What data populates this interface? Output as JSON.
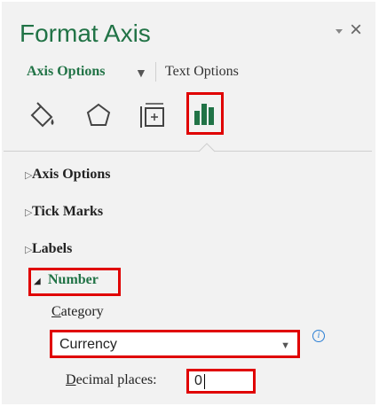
{
  "pane": {
    "title": "Format Axis",
    "pin_icon": "chevron-down-icon",
    "close_symbol": "×",
    "colors": {
      "accent": "#217346",
      "highlight": "#e00000",
      "info": "#2b7fd4"
    }
  },
  "tabs": {
    "axis_options_label": "Axis Options",
    "axis_options_caret": "▼",
    "text_options_label": "Text Options"
  },
  "icons": [
    {
      "name": "fill-line-icon"
    },
    {
      "name": "effects-icon"
    },
    {
      "name": "size-properties-icon"
    },
    {
      "name": "axis-options-icon",
      "selected": true
    }
  ],
  "sections": {
    "axis_options": "Axis Options",
    "tick_marks": "Tick Marks",
    "labels": "Labels",
    "number": "Number",
    "collapsed_glyph": "▷",
    "expanded_glyph": "◢"
  },
  "number": {
    "category_label": "Category",
    "category_value": "Currency",
    "category_caret": "▼",
    "info_symbol": "i",
    "decimal_label": "Decimal places:",
    "decimal_value": "0"
  }
}
